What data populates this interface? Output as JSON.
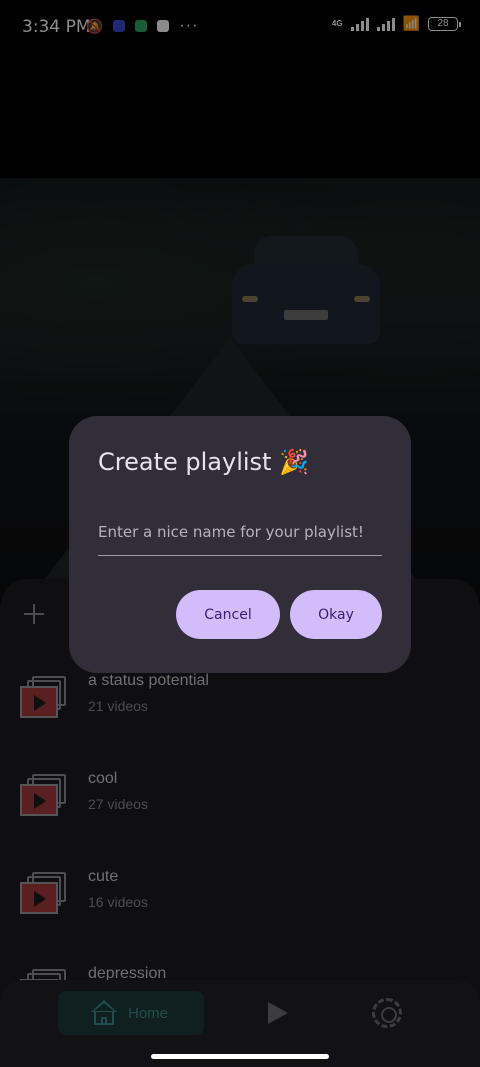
{
  "status_bar": {
    "time": "3:34 PM",
    "more": "···",
    "network": "4G",
    "battery": "28"
  },
  "icons": [
    "mute-bell-icon",
    "app-notification-icon",
    "whatsapp-icon",
    "phone-icon",
    "signal-icon",
    "wifi-icon",
    "battery-icon",
    "add-icon",
    "playlist-stack-icon",
    "home-icon",
    "play-icon",
    "settings-icon"
  ],
  "playlists": [
    {
      "title": "a status potential",
      "count": "21 videos"
    },
    {
      "title": "cool",
      "count": "27 videos"
    },
    {
      "title": "cute",
      "count": "16 videos"
    },
    {
      "title": "depression",
      "count": ""
    }
  ],
  "bottom_nav": {
    "home_label": "Home"
  },
  "dialog": {
    "title": "Create playlist 🎉",
    "input_placeholder": "Enter a nice name for your playlist!",
    "input_value": "",
    "cancel_label": "Cancel",
    "okay_label": "Okay"
  },
  "colors": {
    "accent_button": "#d2bcfa",
    "dialog_bg": "#322e39",
    "home_active": "#3d8f8a",
    "thumbnail_red": "#a43a3c"
  }
}
